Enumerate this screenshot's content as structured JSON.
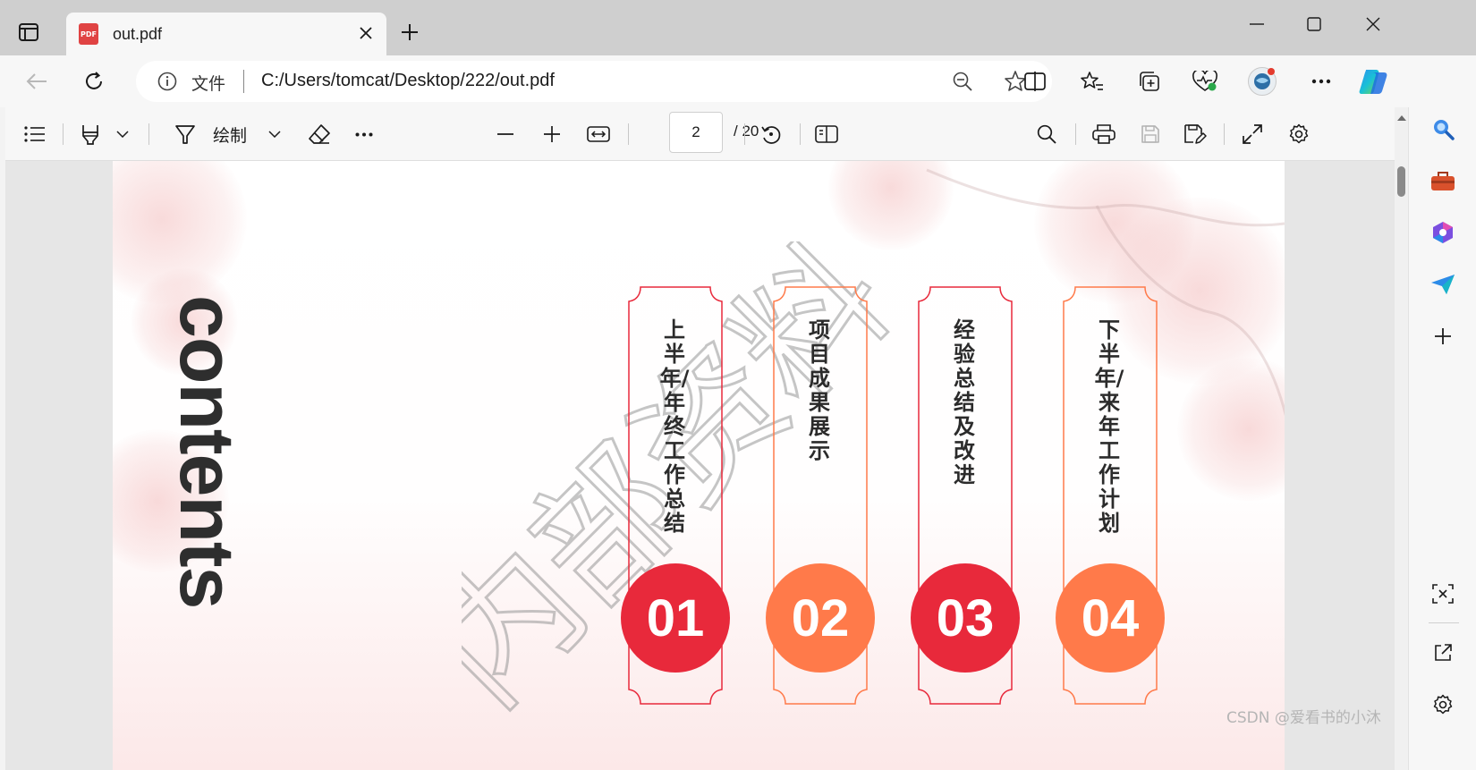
{
  "browser": {
    "tab": {
      "title": "out.pdf",
      "badge": "PDF"
    },
    "address": {
      "site_label": "文件",
      "url": "C:/Users/tomcat/Desktop/222/out.pdf"
    }
  },
  "pdf_toolbar": {
    "draw_label": "绘制",
    "page_current": "2",
    "page_total": "/ 20"
  },
  "document": {
    "title": "contents",
    "watermark": "内部资料",
    "sections": [
      {
        "number": "01",
        "text": "上半年/年终工作总结",
        "color": "#e8293b"
      },
      {
        "number": "02",
        "text": "项目成果展示",
        "color": "#ff7a4a"
      },
      {
        "number": "03",
        "text": "经验总结及改进",
        "color": "#e8293b"
      },
      {
        "number": "04",
        "text": "下半年/来年工作计划",
        "color": "#ff7a4a"
      }
    ]
  },
  "overlay_text": "CSDN @爱看书的小沐",
  "colors": {
    "accent_red": "#e8293b",
    "accent_orange": "#ff7a4a",
    "toolbar_bg": "#f7f7f7",
    "tabstrip_bg": "#cfcfcf"
  }
}
